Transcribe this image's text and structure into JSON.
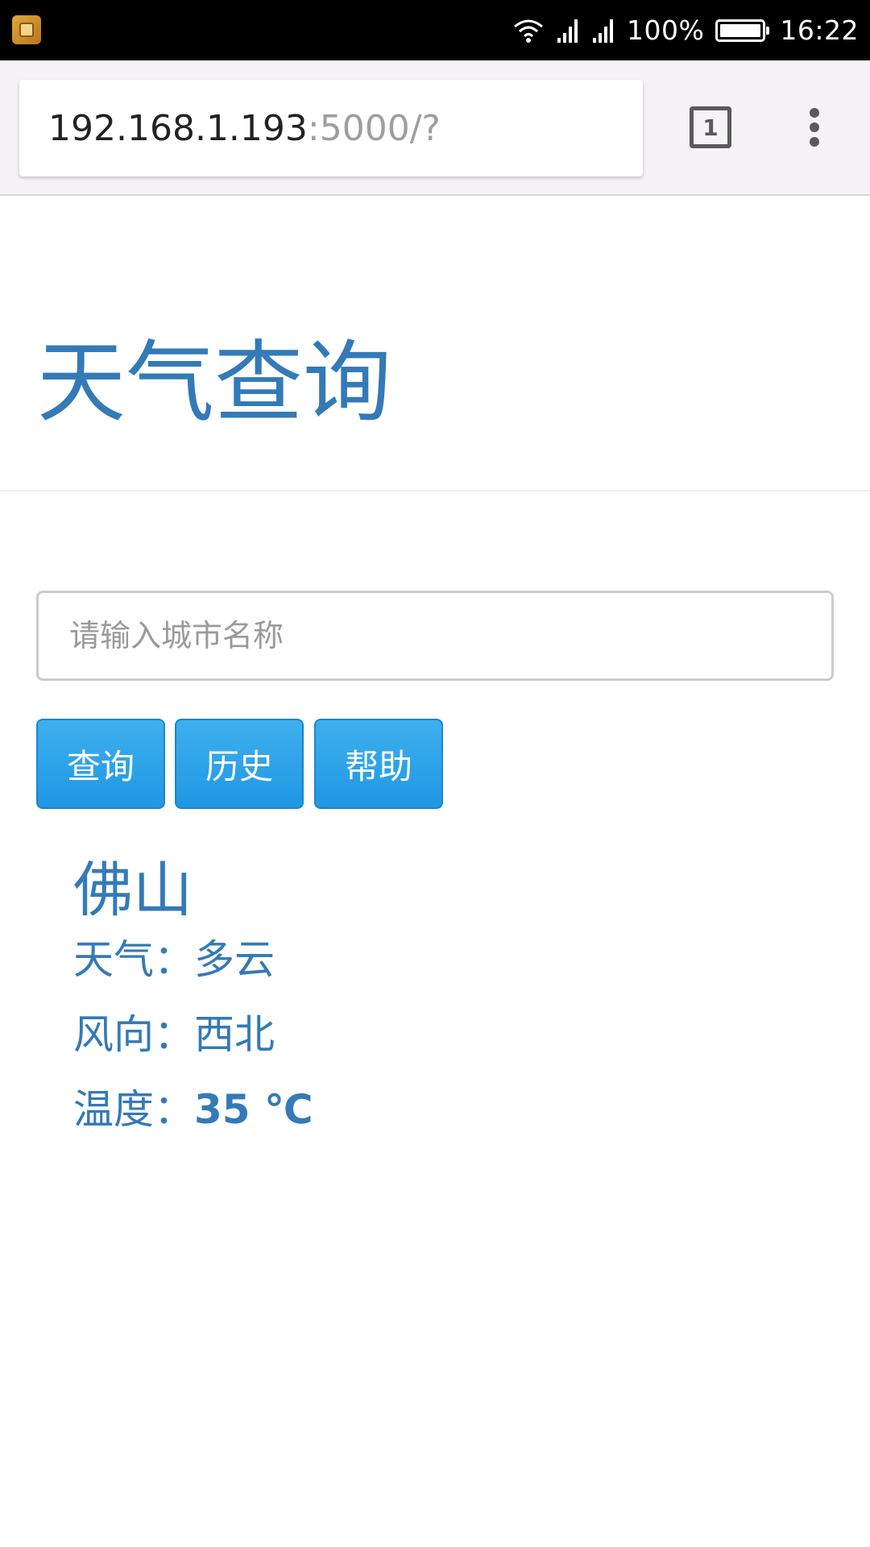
{
  "status_bar": {
    "battery_percent": "100%",
    "time": "16:22",
    "icons": [
      "app-notification-icon",
      "wifi-icon",
      "signal-icon",
      "signal-icon",
      "battery-icon"
    ]
  },
  "browser": {
    "url_host": "192.168.1.193",
    "url_rest": ":5000/?",
    "tab_count": "1"
  },
  "page": {
    "title": "天气查询",
    "search": {
      "placeholder": "请输入城市名称",
      "value": ""
    },
    "buttons": {
      "query": "查询",
      "history": "历史",
      "help": "帮助"
    },
    "result": {
      "city": "佛山",
      "weather_label": "天气：",
      "weather_value": "多云",
      "wind_label": "风向：",
      "wind_value": "西北",
      "temp_label": "温度：",
      "temp_value": "35 ℃"
    }
  },
  "colors": {
    "accent_text": "#337ab7",
    "button_bg": "#2aa0e8",
    "status_bar_bg": "#000000",
    "toolbar_bg": "#f5f3f5"
  }
}
